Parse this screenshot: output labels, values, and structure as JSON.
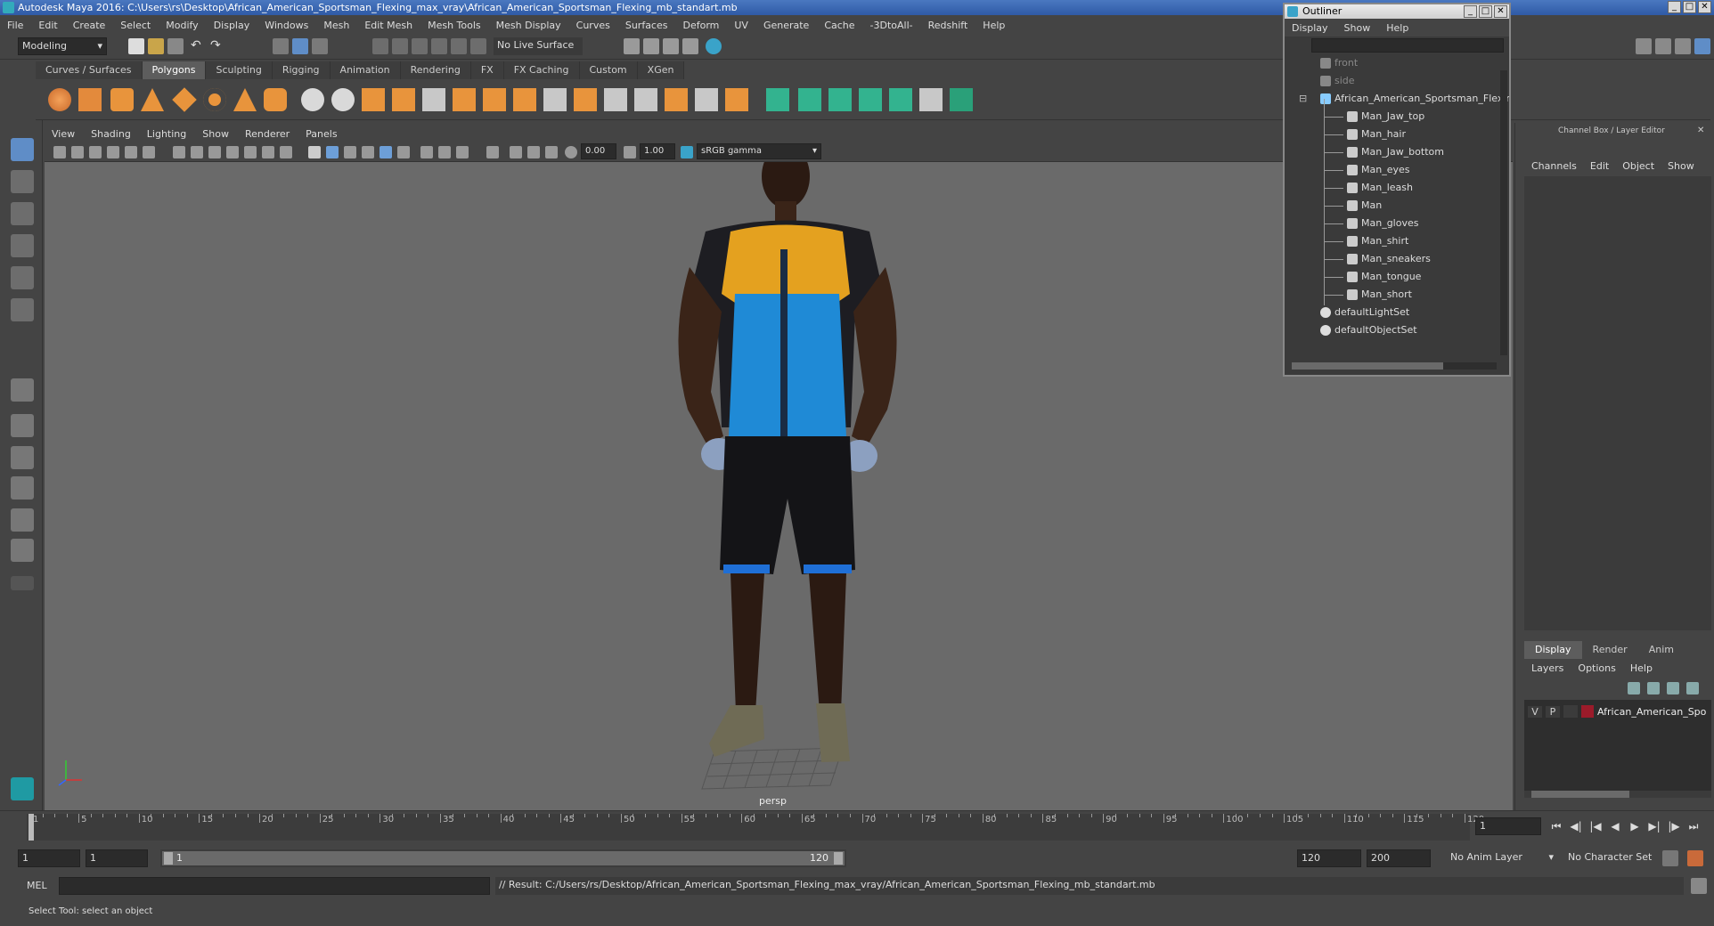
{
  "window": {
    "title": "Autodesk Maya 2016: C:\\Users\\rs\\Desktop\\African_American_Sportsman_Flexing_max_vray\\African_American_Sportsman_Flexing_mb_standart.mb"
  },
  "menubar": [
    "File",
    "Edit",
    "Create",
    "Select",
    "Modify",
    "Display",
    "Windows",
    "Mesh",
    "Edit Mesh",
    "Mesh Tools",
    "Mesh Display",
    "Curves",
    "Surfaces",
    "Deform",
    "UV",
    "Generate",
    "Cache",
    "-3DtoAll-",
    "Redshift",
    "Help"
  ],
  "statusline": {
    "mode": "Modeling",
    "live_surface": "No Live Surface"
  },
  "shelf_tabs": [
    "Curves / Surfaces",
    "Polygons",
    "Sculpting",
    "Rigging",
    "Animation",
    "Rendering",
    "FX",
    "FX Caching",
    "Custom",
    "XGen"
  ],
  "shelf_active": "Polygons",
  "viewport": {
    "menu": [
      "View",
      "Shading",
      "Lighting",
      "Show",
      "Renderer",
      "Panels"
    ],
    "exposure": "0.00",
    "gamma": "1.00",
    "color_space": "sRGB gamma",
    "camera_label": "persp"
  },
  "outliner": {
    "title": "Outliner",
    "menu": [
      "Display",
      "Show",
      "Help"
    ],
    "items": [
      {
        "label": "front",
        "type": "camera",
        "dim": true
      },
      {
        "label": "side",
        "type": "camera",
        "dim": true
      },
      {
        "label": "African_American_Sportsman_Flexing",
        "type": "group"
      },
      {
        "label": "Man_Jaw_top",
        "type": "mesh"
      },
      {
        "label": "Man_hair",
        "type": "mesh"
      },
      {
        "label": "Man_Jaw_bottom",
        "type": "mesh"
      },
      {
        "label": "Man_eyes",
        "type": "mesh"
      },
      {
        "label": "Man_leash",
        "type": "mesh"
      },
      {
        "label": "Man",
        "type": "mesh"
      },
      {
        "label": "Man_gloves",
        "type": "mesh"
      },
      {
        "label": "Man_shirt",
        "type": "mesh"
      },
      {
        "label": "Man_sneakers",
        "type": "mesh"
      },
      {
        "label": "Man_tongue",
        "type": "mesh"
      },
      {
        "label": "Man_short",
        "type": "mesh"
      },
      {
        "label": "defaultLightSet",
        "type": "set"
      },
      {
        "label": "defaultObjectSet",
        "type": "set"
      }
    ]
  },
  "channelbox": {
    "title": "Channel Box / Layer Editor",
    "menu": [
      "Channels",
      "Edit",
      "Object",
      "Show"
    ],
    "layer_tabs": [
      "Display",
      "Render",
      "Anim"
    ],
    "layer_tab_active": "Display",
    "layer_menu": [
      "Layers",
      "Options",
      "Help"
    ],
    "layer": {
      "v": "V",
      "p": "P",
      "name": "African_American_Spo",
      "color": "#9b1b2a"
    }
  },
  "timeline": {
    "ticks": [
      "1",
      "5",
      "10",
      "15",
      "20",
      "25",
      "30",
      "35",
      "40",
      "45",
      "50",
      "55",
      "60",
      "65",
      "70",
      "75",
      "80",
      "85",
      "90",
      "95",
      "100",
      "105",
      "110",
      "115",
      "120"
    ],
    "current_frame": "1"
  },
  "range": {
    "start": "1",
    "playback_start": "1",
    "slider_start": "1",
    "slider_end": "120",
    "playback_end": "120",
    "end": "200",
    "anim_layer": "No Anim Layer",
    "character_set": "No Character Set"
  },
  "command": {
    "lang": "MEL",
    "result": "// Result: C:/Users/rs/Desktop/African_American_Sportsman_Flexing_max_vray/African_American_Sportsman_Flexing_mb_standart.mb"
  },
  "help_line": "Select Tool: select an object",
  "colors": {
    "accent": "#4a78c0",
    "viewport_bg": "#6a6a6a",
    "shirt_blue": "#1f8ad6",
    "shirt_yellow": "#e4a11f"
  }
}
